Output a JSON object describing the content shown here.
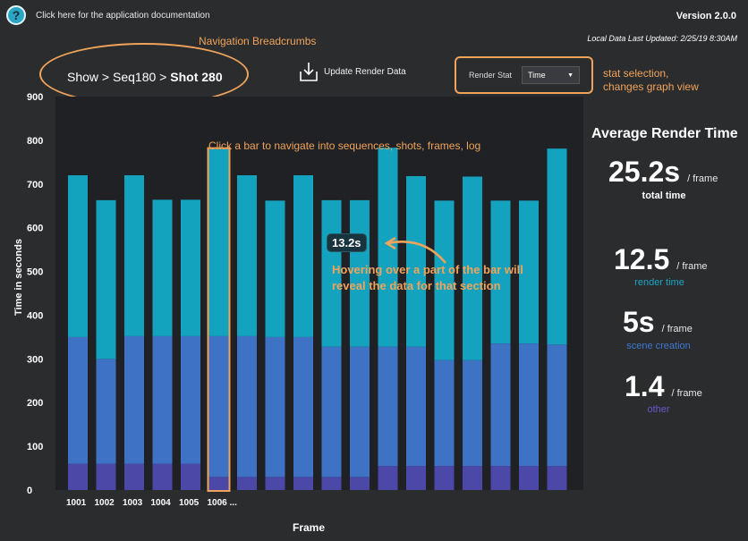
{
  "header": {
    "help_icon": "?",
    "doc_link": "Click here for the application documentation",
    "version": "Version 2.0.0",
    "last_updated": "Local Data Last Updated: 2/25/19 8:30AM"
  },
  "annotations": {
    "breadcrumbs": "Navigation Breadcrumbs",
    "stat": [
      "stat selection,",
      "changes graph view"
    ],
    "click": "Click a bar to navigate into sequences, shots, frames, log",
    "hover": "Hovering over a part of the bar will reveal the data for that section"
  },
  "breadcrumb": {
    "show": "Show",
    "sep": ">",
    "seq": "Seq180",
    "shot": "Shot 280"
  },
  "toolbar": {
    "update_label": "Update Render Data",
    "render_stat_label": "Render Stat",
    "render_stat_value": "Time"
  },
  "tooltip": "13.2s",
  "summary": {
    "title": "Average Render Time",
    "rows": [
      {
        "value": "25.2s",
        "unit": "/ frame",
        "label": "total time",
        "color": "#ffffff"
      },
      {
        "value": "12.5",
        "unit": "/ frame",
        "label": "render time",
        "color": "#19a5c6"
      },
      {
        "value": "5s",
        "unit": "/ frame",
        "label": "scene creation",
        "color": "#3e78d2"
      },
      {
        "value": "1.4",
        "unit": "/ frame",
        "label": "other",
        "color": "#6a57c8"
      }
    ]
  },
  "chart_data": {
    "type": "bar",
    "stacked": true,
    "xlabel": "Frame",
    "ylabel": "Time in seconds",
    "ylim": [
      0,
      900
    ],
    "yticks": [
      0,
      100,
      200,
      300,
      400,
      500,
      600,
      700,
      800,
      900
    ],
    "categories": [
      "1001",
      "1002",
      "1003",
      "1004",
      "1005",
      "1006 ...",
      "",
      "",
      "",
      "",
      "",
      "",
      "",
      "",
      "",
      "",
      "",
      ""
    ],
    "highlighted_index": 5,
    "series": [
      {
        "color": "#4b48a8",
        "values": [
          60,
          60,
          60,
          60,
          60,
          30,
          30,
          30,
          30,
          30,
          30,
          55,
          55,
          55,
          55,
          55,
          55,
          55
        ]
      },
      {
        "color": "#3e72c4",
        "values": [
          290,
          240,
          292,
          292,
          292,
          322,
          322,
          320,
          320,
          298,
          298,
          273,
          273,
          242,
          242,
          280,
          280,
          278
        ]
      },
      {
        "color": "#14a3bf",
        "values": [
          370,
          363,
          368,
          312,
          312,
          428,
          368,
          312,
          370,
          335,
          335,
          455,
          390,
          365,
          420,
          327,
          327,
          448
        ]
      }
    ]
  }
}
